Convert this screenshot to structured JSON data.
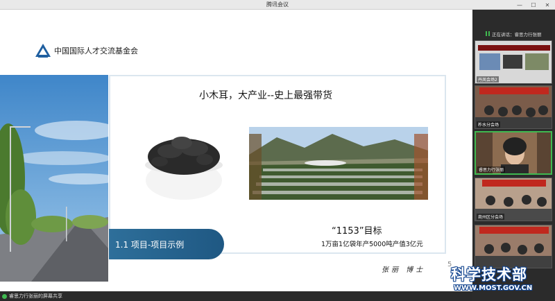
{
  "window": {
    "title": "腾讯会议",
    "controls": [
      "—",
      "☐",
      "✕"
    ]
  },
  "slide": {
    "org_name": "中国国际人才交流基金会",
    "headline": "小木耳，大产业--史上最强带货",
    "section_tag": "1.1  项目-项目示例",
    "goal_title": "“1153”目标",
    "goal_subtitle": "1万亩1亿袋年产5000吨产值3亿元",
    "signature": "张丽 博士",
    "slide_number": "5"
  },
  "status_bar": {
    "share_text": "睿思力行张丽的屏幕共享"
  },
  "panel": {
    "speaking_text": "正在讲话：睿思力行张丽",
    "tiles": [
      {
        "label": "丹凤会场2"
      },
      {
        "label": "柞水分会场"
      },
      {
        "label": "睿思力行张丽"
      },
      {
        "label": "商州区分会场"
      },
      {
        "label": ""
      }
    ]
  },
  "watermark": {
    "title": "科学技术部",
    "url": "WWW.MOST.GOV.CN"
  },
  "colors": {
    "speaking_green": "#3fb950",
    "section_blue": "#2e6f9a",
    "watermark_blue": "#12448f"
  }
}
